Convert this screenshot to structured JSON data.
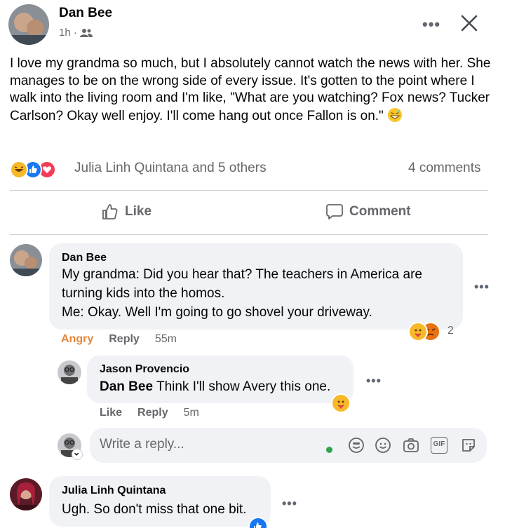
{
  "post": {
    "author": "Dan Bee",
    "time": "1h ·",
    "text": "I love my grandma so much, but I absolutely cannot watch the news with her. She manages to be on the wrong side of every issue. It's gotten to the point where I walk into the living room and I'm like, \"What are you watching? Fox news? Tucker Carlson? Okay well enjoy. I'll come hang out once Fallon is on.\"",
    "reactions_text": "Julia Linh Quintana and 5 others",
    "comments_count": "4 comments",
    "like_label": "Like",
    "comment_label": "Comment",
    "more_label": "•••"
  },
  "comments": [
    {
      "author": "Dan Bee",
      "lines": [
        "My grandma: Did you hear that? The teachers in America are",
        "turning kids into the homos.",
        "Me: Okay. Well I'm going to go shovel your driveway."
      ],
      "reaction_label": "Angry",
      "reply_label": "Reply",
      "time": "55m",
      "reaction_count": "2"
    },
    {
      "author": "Jason Provencio",
      "mention": "Dan Bee",
      "text": " Think I'll show Avery this one.",
      "like_label": "Like",
      "reply_label": "Reply",
      "time": "5m"
    },
    {
      "author": "Julia Linh Quintana",
      "text": "Ugh. So don't miss that one bit."
    }
  ],
  "reply_box": {
    "placeholder": "Write a reply...",
    "gif_label": "GIF"
  },
  "colors": {
    "like_blue": "#1877f2",
    "love_red": "#f33e58",
    "haha_yellow": "#f7b928",
    "angry_orange": "#e4873b",
    "online_green": "#31a24c",
    "muted_text": "#65676b"
  },
  "icons": {
    "close": "close-icon",
    "audience": "friends-icon",
    "like": "thumbs-up-icon",
    "comment": "speech-bubble-icon",
    "sticker": "sticker-icon",
    "emoji": "smiley-icon",
    "camera": "camera-icon",
    "gif": "gif-icon",
    "avatar_sticker": "avatar-sticker-icon"
  }
}
